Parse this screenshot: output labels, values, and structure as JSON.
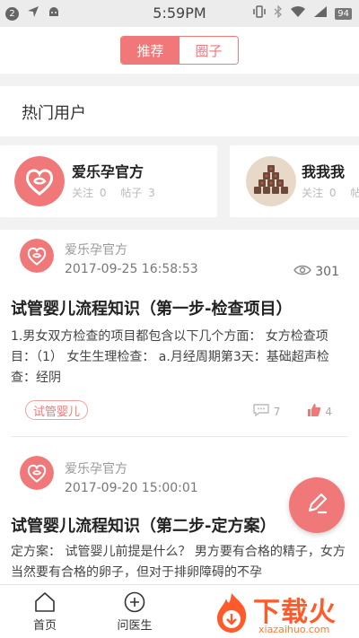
{
  "status_bar": {
    "notification_count": "2",
    "time": "5:59PM",
    "battery": "94"
  },
  "top_tabs": [
    "推荐",
    "圈子"
  ],
  "hot_users": {
    "title": "热门用户",
    "users": [
      {
        "name": "爱乐孕官方",
        "follow_label": "关注",
        "follow_count": "0",
        "posts_label": "帖子",
        "posts_count": "3"
      },
      {
        "name": "我我我",
        "follow_label": "关注",
        "follow_count": "0",
        "posts_label": "帖",
        "posts_count": ""
      }
    ]
  },
  "posts": [
    {
      "author": "爱乐孕官方",
      "time": "2017-09-25 16:58:53",
      "views": "301",
      "title": "试管婴儿流程知识（第一步-检查项目）",
      "body": "1.男女双方检查的项目都包含以下几个方面：  女方检查项目：（1）  女生生理检查：  a.月经周期第3天：基础超声检查：经阴",
      "tag": "试管婴儿",
      "comments": "7",
      "likes": "4"
    },
    {
      "author": "爱乐孕官方",
      "time": "2017-09-20 15:00:01",
      "title": "试管婴儿流程知识（第二步-定方案）",
      "body": "定方案：  试管婴儿前提是什么？  男方要有合格的精子，女方当然要有合格的卵子，但对于排卵障碍的不孕"
    }
  ],
  "bottom_nav": [
    {
      "label": "首页",
      "icon": "home-icon"
    },
    {
      "label": "问医生",
      "icon": "plus-circle-icon"
    }
  ],
  "watermark": {
    "text": "下载火",
    "url": "xiazaihuo.com"
  },
  "colors": {
    "accent": "#f07878",
    "watermark": "#ff5a2a"
  }
}
